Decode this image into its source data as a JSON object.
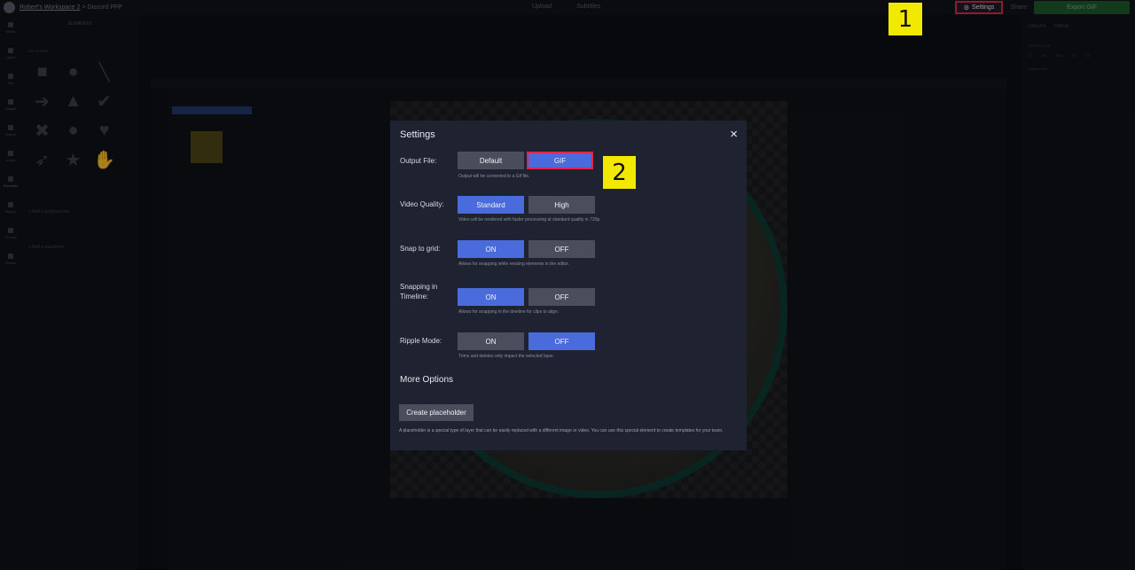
{
  "topbar": {
    "workspace": "Robert's Workspace 2",
    "separator": ">",
    "project": "Discord PFP",
    "upload": "Upload",
    "subtitles": "Subtitles",
    "settings": "Settings",
    "share": "Share",
    "export": "Export GIF"
  },
  "rail": [
    "Media",
    "Layers",
    "Text",
    "Images",
    "Videos",
    "Audio",
    "Elements",
    "Plugins",
    "Record",
    "Stories"
  ],
  "elements_panel": {
    "title": "ELEMENTS",
    "section": "ADD SHAPE",
    "progress_bar": "+ Add a progress bar",
    "waveform": "+ Add a waveform"
  },
  "right_panel": {
    "tabs": [
      "CANVAS",
      "TIMING"
    ],
    "output_size": "OUTPUT SIZE",
    "ratios": [
      "1:1",
      "4:3",
      "16:9",
      "4:5",
      "5:4"
    ],
    "custom": "Custom Size"
  },
  "modal": {
    "title": "Settings",
    "close": "×",
    "output_file": {
      "label": "Output File:",
      "options": [
        "Default",
        "GIF"
      ],
      "selected": "GIF",
      "desc": "Output will be converted to a Gif file."
    },
    "video_quality": {
      "label": "Video Quality:",
      "options": [
        "Standard",
        "High"
      ],
      "selected": "Standard",
      "desc": "Video will be rendered with faster processing at standard quality in 720p."
    },
    "snap_grid": {
      "label": "Snap to grid:",
      "options": [
        "ON",
        "OFF"
      ],
      "selected": "ON",
      "desc": "Allows for snapping while resizing elements in the editor."
    },
    "snap_timeline": {
      "label": "Snapping in Timeline:",
      "options": [
        "ON",
        "OFF"
      ],
      "selected": "ON",
      "desc": "Allows for snapping in the timeline for clips to align."
    },
    "ripple": {
      "label": "Ripple Mode:",
      "options": [
        "ON",
        "OFF"
      ],
      "selected": "OFF",
      "desc": "Trims and deletes only impact the selected layer."
    },
    "more_options": "More Options",
    "create_placeholder": "Create placeholder",
    "placeholder_desc": "A placeholder is a special type of layer that can be easily replaced with a different image or video. You can use this special element to create templates for your team."
  },
  "callouts": [
    "1",
    "2"
  ],
  "colors": {
    "accent": "#4a6bdc",
    "highlight": "#e0254a",
    "callout": "#f2e900"
  }
}
